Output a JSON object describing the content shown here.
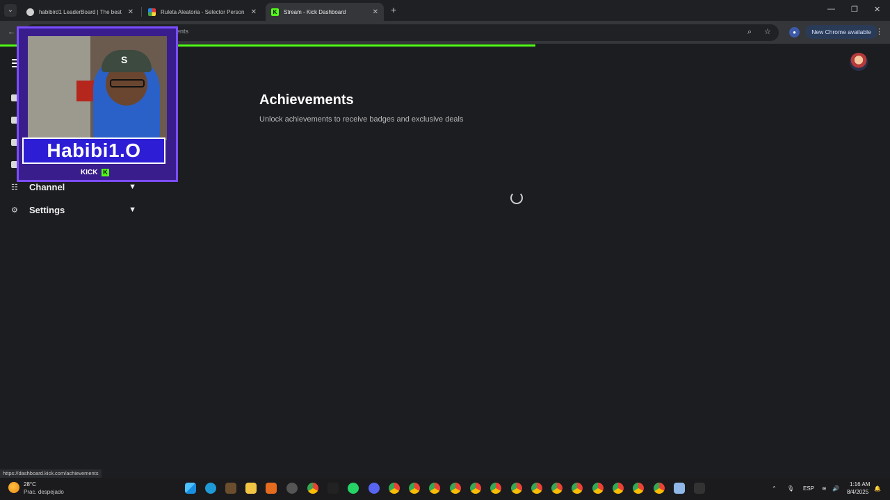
{
  "browser": {
    "tabs": [
      {
        "title": "habibird1 LeaderBoard | The best",
        "active": false
      },
      {
        "title": "Ruleta Aleatoria - Selector Person",
        "active": false
      },
      {
        "title": "Stream - Kick Dashboard",
        "active": true
      }
    ],
    "address_url_visible": "ents",
    "new_chrome_label": "New Chrome available",
    "status_url": "https://dashboard.kick.com/achievements",
    "progress_fraction": 0.6
  },
  "sidebar": {
    "items": [
      {
        "label": "Channel",
        "icon": "channel-icon"
      },
      {
        "label": "Settings",
        "icon": "gear-icon"
      }
    ]
  },
  "main": {
    "title": "Achievements",
    "subtitle": "Unlock achievements to receive badges and exclusive deals"
  },
  "webcam": {
    "name": "Habibi1.O",
    "brand": "KICK"
  },
  "taskbar": {
    "weather_temp": "28°C",
    "weather_desc": "Prac. despejado",
    "language": "ESP",
    "time": "1:16 AM",
    "date": "8/4/2025"
  },
  "colors": {
    "kick_green": "#53fc18",
    "background": "#1c1d21"
  }
}
